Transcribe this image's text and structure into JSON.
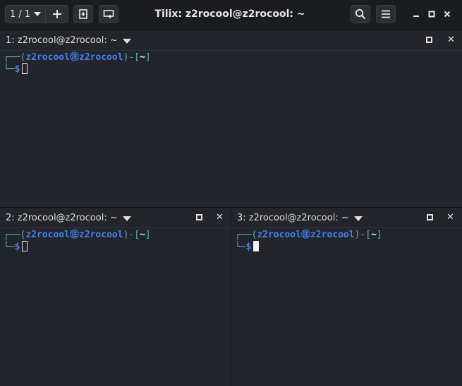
{
  "headerbar": {
    "session_label": "1 / 1",
    "title": "Tilix: z2rocool@z2rocool: ~",
    "icons": [
      "chevron-down-icon",
      "plus-icon",
      "add-terminal-icon",
      "add-window-icon",
      "search-icon",
      "hamburger-menu-icon",
      "minimize-icon",
      "maximize-icon",
      "close-icon"
    ]
  },
  "panes": [
    {
      "title": "1: z2rocool@z2rocool: ~",
      "prompt_user": "z2rocool",
      "prompt_host": "z2rocool",
      "prompt_symbol": "㊟",
      "prompt_dir": "~",
      "prompt_dollar": "$",
      "cursor": "outline"
    },
    {
      "title": "2: z2rocool@z2rocool: ~",
      "prompt_user": "z2rocool",
      "prompt_host": "z2rocool",
      "prompt_symbol": "㊟",
      "prompt_dir": "~",
      "prompt_dollar": "$",
      "cursor": "outline"
    },
    {
      "title": "3: z2rocool@z2rocool: ~",
      "prompt_user": "z2rocool",
      "prompt_host": "z2rocool",
      "prompt_symbol": "㊟",
      "prompt_dir": "~",
      "prompt_dollar": "$",
      "cursor": "filled"
    }
  ],
  "colors": {
    "prompt_line": "#4fb8a7",
    "prompt_user": "#3e82ef",
    "background": "#23252b"
  }
}
